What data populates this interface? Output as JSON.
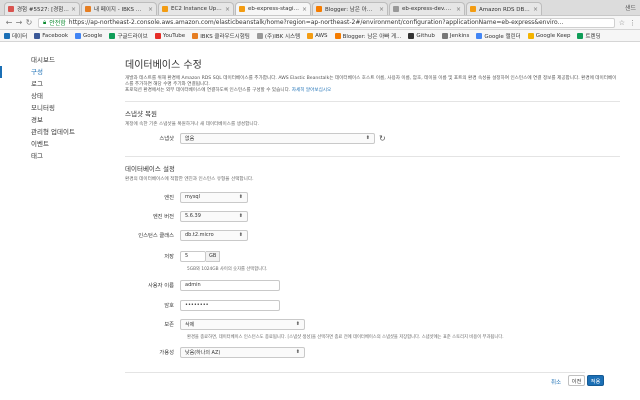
{
  "browser": {
    "tabs": [
      {
        "label": "경험 #5527: [경험] 분만",
        "color": "#d9534f",
        "active": false
      },
      {
        "label": "내 페이지 - IBKS 플랫폼",
        "color": "#e67e22",
        "active": false
      },
      {
        "label": "EC2 Instance Update",
        "color": "#f39c12",
        "active": false
      },
      {
        "label": "eb-express-staging - ...",
        "color": "#f39c12",
        "active": true
      },
      {
        "label": "Blogger: 남은 아빠 게임...",
        "color": "#f57c00",
        "active": false
      },
      {
        "label": "eb-express-dev.hurida...",
        "color": "#999999",
        "active": false
      },
      {
        "label": "Amazon RDS DB 인스...",
        "color": "#f39c12",
        "active": false
      }
    ],
    "tabs_right": "샌드",
    "secure_label": "안전함",
    "url": "https://ap-northeast-2.console.aws.amazon.com/elasticbeanstalk/home?region=ap-northeast-2#/environment/configuration?applicationName=eb-express&enviro...",
    "bookmarks": [
      {
        "label": "데이터",
        "color": "#1b6fb5"
      },
      {
        "label": "Facebook",
        "color": "#3b5998"
      },
      {
        "label": "Google",
        "color": "#4285f4"
      },
      {
        "label": "구글드라이브",
        "color": "#0f9d58"
      },
      {
        "label": "YouTube",
        "color": "#e52d27"
      },
      {
        "label": "IBKS 클라우드시험팀",
        "color": "#e67e22"
      },
      {
        "label": "(주)IBK 시스템",
        "color": "#999999"
      },
      {
        "label": "AWS",
        "color": "#f39c12"
      },
      {
        "label": "Blogger: 남은 아빠 게...",
        "color": "#f57c00"
      },
      {
        "label": "Github",
        "color": "#333333"
      },
      {
        "label": "Jenkins",
        "color": "#777777"
      },
      {
        "label": "Google 캘린더",
        "color": "#4285f4"
      },
      {
        "label": "Google Keep",
        "color": "#f4b400"
      },
      {
        "label": "트렌딩",
        "color": "#0f9d58"
      }
    ]
  },
  "sidebar": {
    "items": [
      {
        "label": "대시보드",
        "active": false
      },
      {
        "label": "구성",
        "active": true
      },
      {
        "label": "로그",
        "active": false
      },
      {
        "label": "상태",
        "active": false
      },
      {
        "label": "모니터링",
        "active": false
      },
      {
        "label": "경보",
        "active": false
      },
      {
        "label": "관리형 업데이트",
        "active": false
      },
      {
        "label": "이벤트",
        "active": false
      },
      {
        "label": "태그",
        "active": false
      }
    ]
  },
  "main": {
    "title": "데이터베이스 수정",
    "description": "개발과 테스트를 위해 환경에 Amazon RDS SQL 데이터베이스를 추가합니다. AWS Elastic Beanstalk는 데이터베이스 호스트 이름, 사용자 이름, 암호, 테이블 이름 및 포트의 환경 속성을 설정하여 인스턴스에 연결 정보를 제공합니다. 환경에 데이터베이스를 추가하면 해당 수명 주기와 연결됩니다.",
    "description2": "프로덕션 환경에서는 외부 데이터베이스에 연결하도록 인스턴스를 구성할 수 있습니다.",
    "description_link": "자세히 알아보십시오",
    "snapshot": {
      "title": "스냅샷 복원",
      "subtitle": "계정에 속한 기존 스냅샷을 복원하거나 새 데이터베이스를 생성합니다.",
      "label": "스냅샷",
      "value": "없음"
    },
    "db_settings": {
      "title": "데이터베이스 설정",
      "subtitle": "환경의 데이터베이스에 적합한 엔진과 인스턴스 유형을 선택합니다.",
      "engine_label": "엔진",
      "engine_value": "mysql",
      "version_label": "엔진 버전",
      "version_value": "5.6.39",
      "class_label": "인스턴스 클래스",
      "class_value": "db.t2.micro",
      "storage_label": "저장",
      "storage_value": "5",
      "storage_unit": "GB",
      "storage_hint": "5GB와 1024GB 사이의 숫자를 선택합니다.",
      "username_label": "사용자 이름",
      "username_value": "admin",
      "password_label": "암호",
      "password_value": "••••••••",
      "retention_label": "보존",
      "retention_value": "삭제",
      "retention_hint": "환경을 종료하면, 데이터베이스 인스턴스도 종료됩니다. [스냅샷 생성]을 선택하면 종료 전에 데이터베이스의 스냅샷을 저장합니다. 스냅샷에는 표준 스토리지 비용이 부과됩니다.",
      "availability_label": "가용성",
      "availability_value": "낮음(하나의 AZ)"
    },
    "footer": {
      "cancel": "취소",
      "prev": "이전",
      "save": "적용"
    }
  }
}
